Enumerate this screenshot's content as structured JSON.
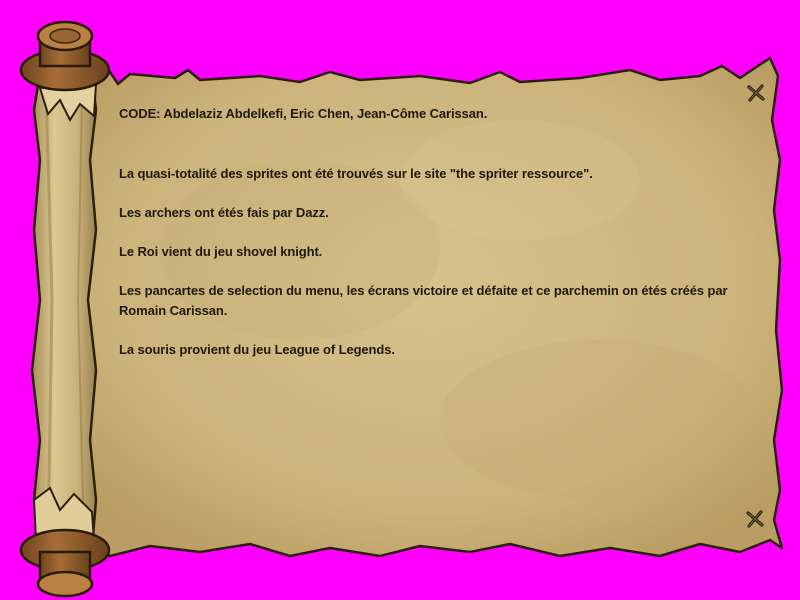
{
  "credits": {
    "code_line": "CODE: Abdelaziz Abdelkefi, Eric Chen, Jean-Côme Carissan.",
    "sprites_line": "La quasi-totalité des sprites ont été trouvés sur le site \"the spriter ressource\".",
    "archers_line": "Les archers ont étés fais par Dazz.",
    "king_line": "Le Roi vient du jeu shovel knight.",
    "signs_line": "Les pancartes de selection du menu, les écrans victoire et défaite et ce parchemin on étés créés par Romain Carissan.",
    "mouse_line": "La souris provient du jeu League of Legends."
  },
  "icons": {
    "top_close": "close-icon",
    "bottom_close": "close-icon"
  },
  "colors": {
    "background": "#ff00ff",
    "parchment": "#cfb77e",
    "wood": "#8b5a2b",
    "text": "#1f1a10"
  }
}
